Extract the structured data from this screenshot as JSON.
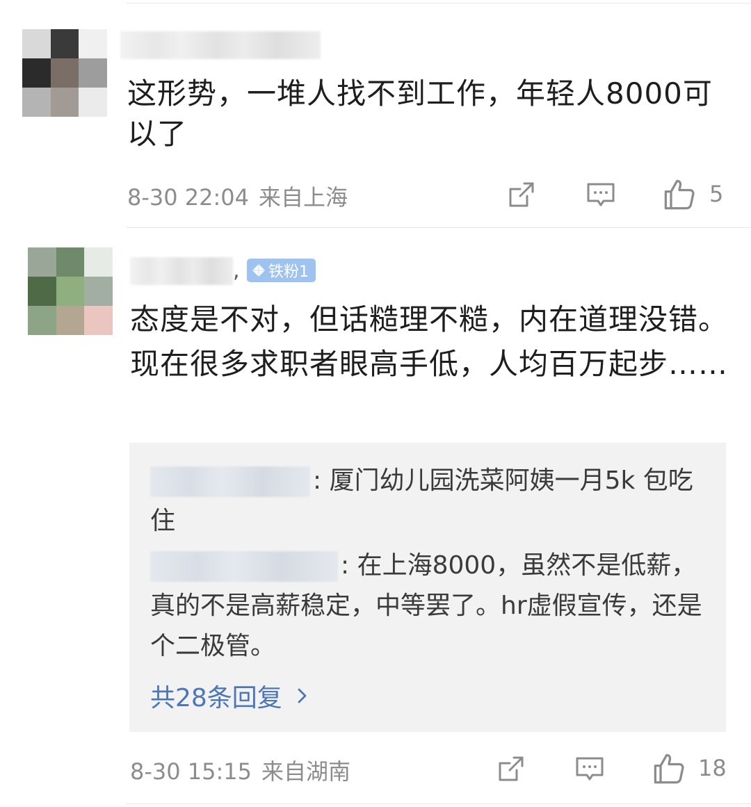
{
  "comments": [
    {
      "text": "这形势，一堆人找不到工作，年轻人8000可以了",
      "date": "8-30 22:04",
      "location": "来自上海",
      "likes": "5"
    },
    {
      "badge": "铁粉1",
      "text": "态度是不对，但话糙理不糙，内在道理没错。现在很多求职者眼高手低，人均百万起步……",
      "replies": [
        {
          "text": ": 厦门幼儿园洗菜阿姨一月5k 包吃住"
        },
        {
          "text": ": 在上海8000，虽然不是低薪，真的不是高薪稳定，中等罢了。hr虚假宣传，还是个二极管。"
        }
      ],
      "more_replies": "共28条回复",
      "date": "8-30 15:15",
      "location": "来自湖南",
      "likes": "18"
    }
  ],
  "icons": {
    "share": "share-icon",
    "comment": "comment-icon",
    "like": "thumbs-up-icon",
    "chevron": "chevron-right-icon",
    "badge": "diamond-icon"
  },
  "colors": {
    "meta_gray": "#8c8c8c",
    "link_blue": "#4c77b5",
    "badge_blue": "#9fc3f0",
    "reply_bg": "#f2f2f2"
  }
}
